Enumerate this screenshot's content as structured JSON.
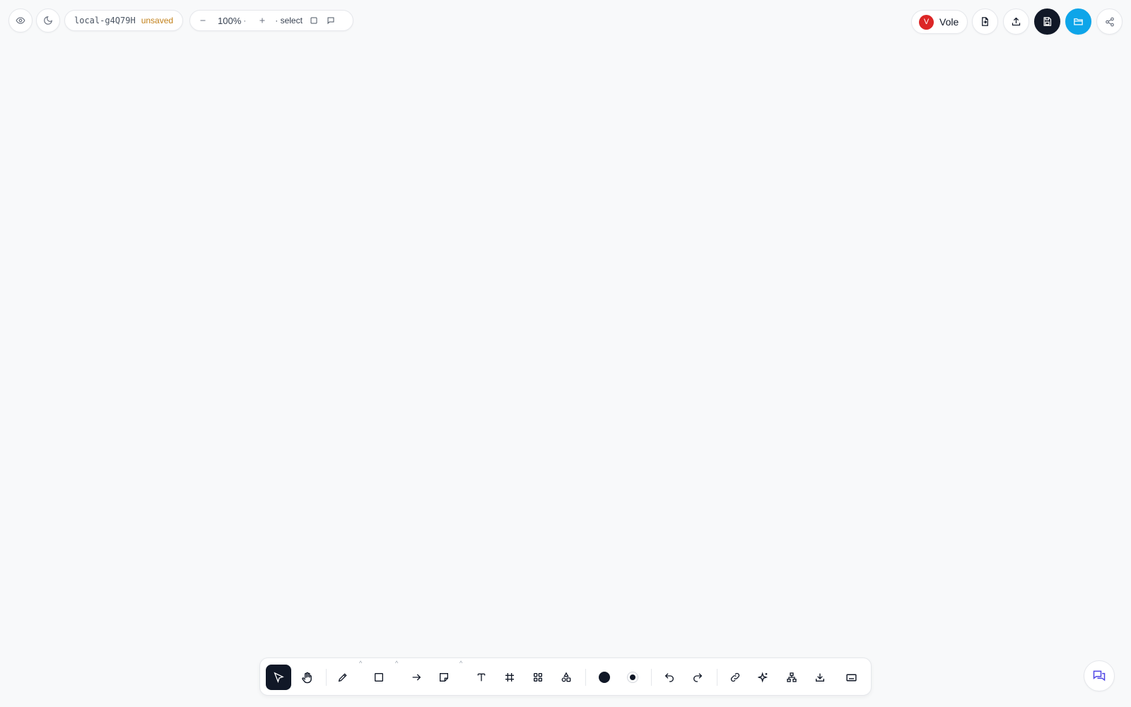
{
  "top_left": {
    "preview_icon": "eye-icon",
    "theme_icon": "moon-icon",
    "doc_id": "local-g4Q79H",
    "doc_status": "unsaved",
    "doc_status_color": "#c2811b",
    "zoom_out_icon": "minus-icon",
    "zoom_value": "100%",
    "zoom_separator": "·",
    "zoom_in_icon": "plus-icon",
    "mode_label": "· select",
    "frame_icon": "square-icon",
    "comment_icon": "comment-icon"
  },
  "top_right": {
    "user_initial": "V",
    "user_name": "Vole",
    "avatar_color": "#dc2626",
    "buttons": [
      "import-icon",
      "upload-icon",
      "save-icon",
      "folder-icon",
      "share-icon"
    ],
    "save_button_color": "#111827",
    "folder_button_color": "#0ea5e9"
  },
  "toolbar": {
    "tools": [
      "select",
      "hand",
      "pencil",
      "rectangle",
      "arrow",
      "note",
      "text",
      "frame",
      "grid",
      "shapes"
    ],
    "active_tool": "select",
    "stroke_color": "#111827",
    "fill_color": "#111827",
    "actions": [
      "undo",
      "redo",
      "link",
      "ai-sparkle",
      "diagram",
      "download",
      "keyboard"
    ]
  },
  "chat_icon": "chat-icon"
}
